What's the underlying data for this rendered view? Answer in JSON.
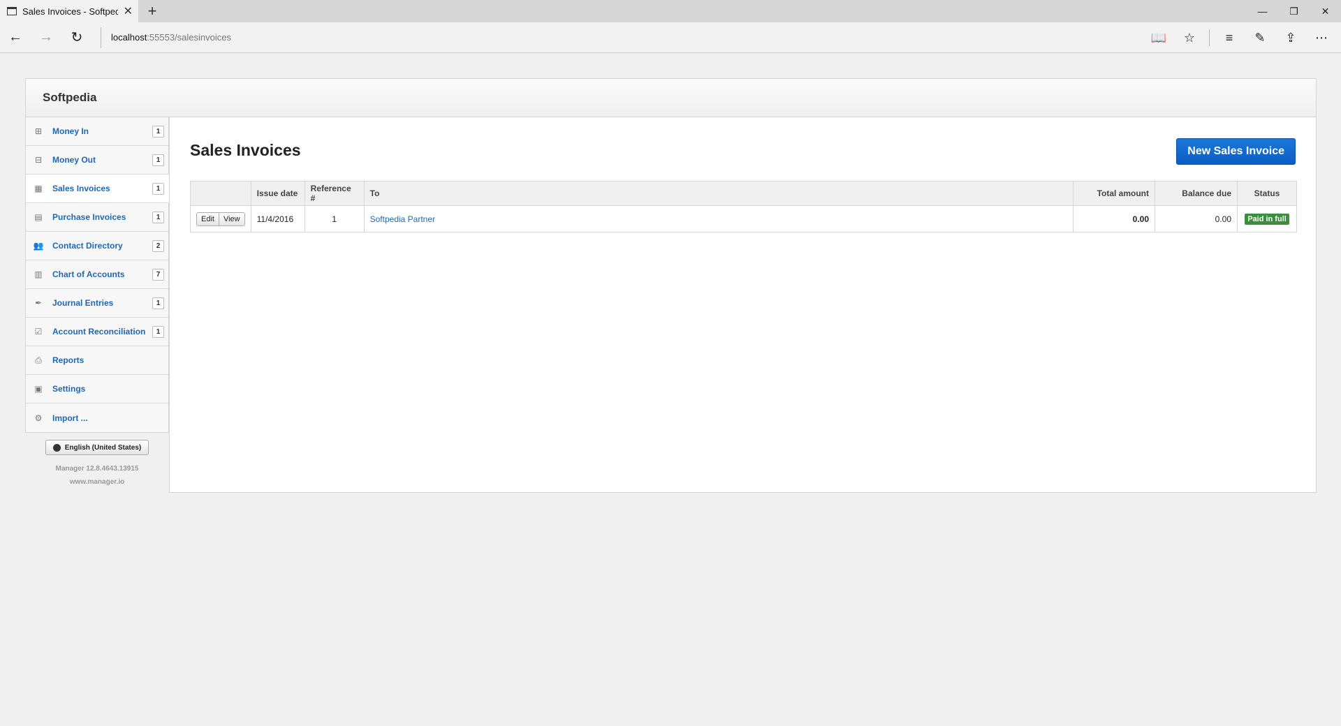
{
  "browser": {
    "tab_title": "Sales Invoices - Softped",
    "url_host": "localhost",
    "url_path": ":55553/salesinvoices"
  },
  "app": {
    "company": "Softpedia",
    "page_title": "Sales Invoices",
    "new_button": "New Sales Invoice"
  },
  "sidebar": {
    "items": [
      {
        "label": "Money In",
        "badge": "1",
        "icon": "plus-square-icon"
      },
      {
        "label": "Money Out",
        "badge": "1",
        "icon": "minus-square-icon"
      },
      {
        "label": "Sales Invoices",
        "badge": "1",
        "icon": "cash-register-icon"
      },
      {
        "label": "Purchase Invoices",
        "badge": "1",
        "icon": "calendar-icon"
      },
      {
        "label": "Contact Directory",
        "badge": "2",
        "icon": "people-icon"
      },
      {
        "label": "Chart of Accounts",
        "badge": "7",
        "icon": "ledger-icon"
      },
      {
        "label": "Journal Entries",
        "badge": "1",
        "icon": "pen-icon"
      },
      {
        "label": "Account Reconciliation",
        "badge": "1",
        "icon": "checkbox-icon"
      },
      {
        "label": "Reports",
        "badge": "",
        "icon": "printer-icon"
      },
      {
        "label": "Settings",
        "badge": "",
        "icon": "settings-icon"
      },
      {
        "label": "Import ...",
        "badge": "",
        "icon": "cogs-icon"
      }
    ],
    "language": "English (United States)",
    "version": "Manager 12.8.4643.13915",
    "website": "www.manager.io"
  },
  "table": {
    "headers": {
      "issue_date": "Issue date",
      "reference": "Reference #",
      "to": "To",
      "total": "Total amount",
      "balance": "Balance due",
      "status": "Status"
    },
    "rows": [
      {
        "edit": "Edit",
        "view": "View",
        "issue_date": "11/4/2016",
        "reference": "1",
        "to": "Softpedia Partner",
        "total": "0.00",
        "balance": "0.00",
        "status": "Paid in full"
      }
    ]
  },
  "colors": {
    "link": "#1f67b1",
    "primary_button": "#0a5ec7",
    "status_paid": "#3b8e3b"
  }
}
